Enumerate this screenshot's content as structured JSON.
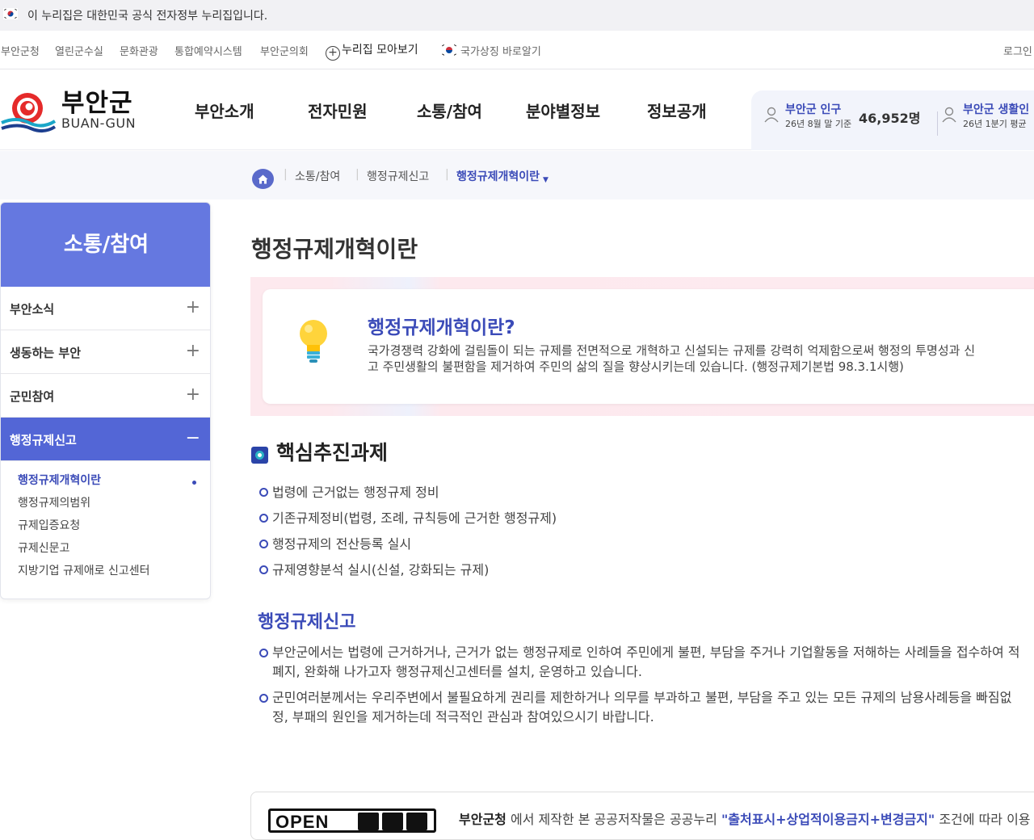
{
  "gov_banner": {
    "text": "이 누리집은 대한민국 공식 전자정부 누리집입니다."
  },
  "util": {
    "links": [
      "부안군청",
      "열린군수실",
      "문화관광",
      "통합예약시스템",
      "부안군의회"
    ],
    "collect": "누리집 모아보기",
    "symbol": "국가상징 바로알기",
    "login": "로그인"
  },
  "logo": {
    "name": "부안군",
    "eng": "BUAN-GUN"
  },
  "gnb": [
    "부안소개",
    "전자민원",
    "소통/참여",
    "분야별정보",
    "정보공개"
  ],
  "stats": {
    "population_label": "부안군 인구",
    "population_sub": "26년 8월 말 기준",
    "population_value": "46,952명",
    "living_label": "부안군 생활인",
    "living_sub": "26년 1분기 평균"
  },
  "breadcrumb": [
    "소통/참여",
    "행정규제신고",
    "행정규제개혁이란"
  ],
  "sidebar": {
    "title": "소통/참여",
    "items": [
      {
        "label": "부안소식",
        "sign": "+"
      },
      {
        "label": "생동하는 부안",
        "sign": "+"
      },
      {
        "label": "군민참여",
        "sign": "+"
      },
      {
        "label": "행정규제신고",
        "sign": "−"
      }
    ],
    "sub_items": [
      "행정규제개혁이란",
      "행정규제의범위",
      "규제입증요청",
      "규제신문고",
      "지방기업 규제애로 신고센터"
    ]
  },
  "page_title": "행정규제개혁이란",
  "intro": {
    "title": "행정규제개혁이란?",
    "text_line1": "국가경쟁력 강화에 걸림돌이 되는 규제를 전면적으로 개혁하고 신설되는 규제를 강력히 억제함으로써 행정의 투명성과 신",
    "text_line2": "고 주민생활의 불편함을 제거하여 주민의 삶의 질을 향상시키는데 있습니다. (행정규제기본법 98.3.1시행)"
  },
  "core": {
    "title": "핵심추진과제",
    "items": [
      "법령에 근거없는 행정규제 정비",
      "기존규제정비(법령, 조례, 규칙등에 근거한 행정규제)",
      "행정규제의 전산등록 실시",
      "규제영향분석 실시(신설, 강화되는 규제)"
    ]
  },
  "report": {
    "title": "행정규제신고",
    "item1_line1": "부안군에서는 법령에 근거하거나, 근거가 없는 행정규제로 인하여 주민에게 불편, 부담을 주거나 기업활동을 저해하는 사례들을 접수하여 적",
    "item1_line2": "폐지, 완화해 나가고자 행정규제신고센터를 설치, 운영하고 있습니다.",
    "item2_line1": "군민여러분께서는 우리주변에서 불필요하게 권리를 제한하거나 의무를 부과하고 불편, 부담을 주고 있는 모든 규제의 남용사례등을 빠짐없",
    "item2_line2": "정, 부패의 원인을 제거하는데 적극적인 관심과 참여있으시기 바랍니다."
  },
  "license": {
    "logo_text": "OPEN",
    "org": "부안군청",
    "text_a": " 에서 제작한 본 공공저작물은 공공누리 ",
    "terms": "\"출처표시+상업적이용금지+변경금지\"",
    "text_b": " 조건에 따라 이용"
  },
  "colors": {
    "accent": "#3b4bb8",
    "sidebar_title": "#6578e0",
    "sidebar_active": "#5366d6"
  }
}
